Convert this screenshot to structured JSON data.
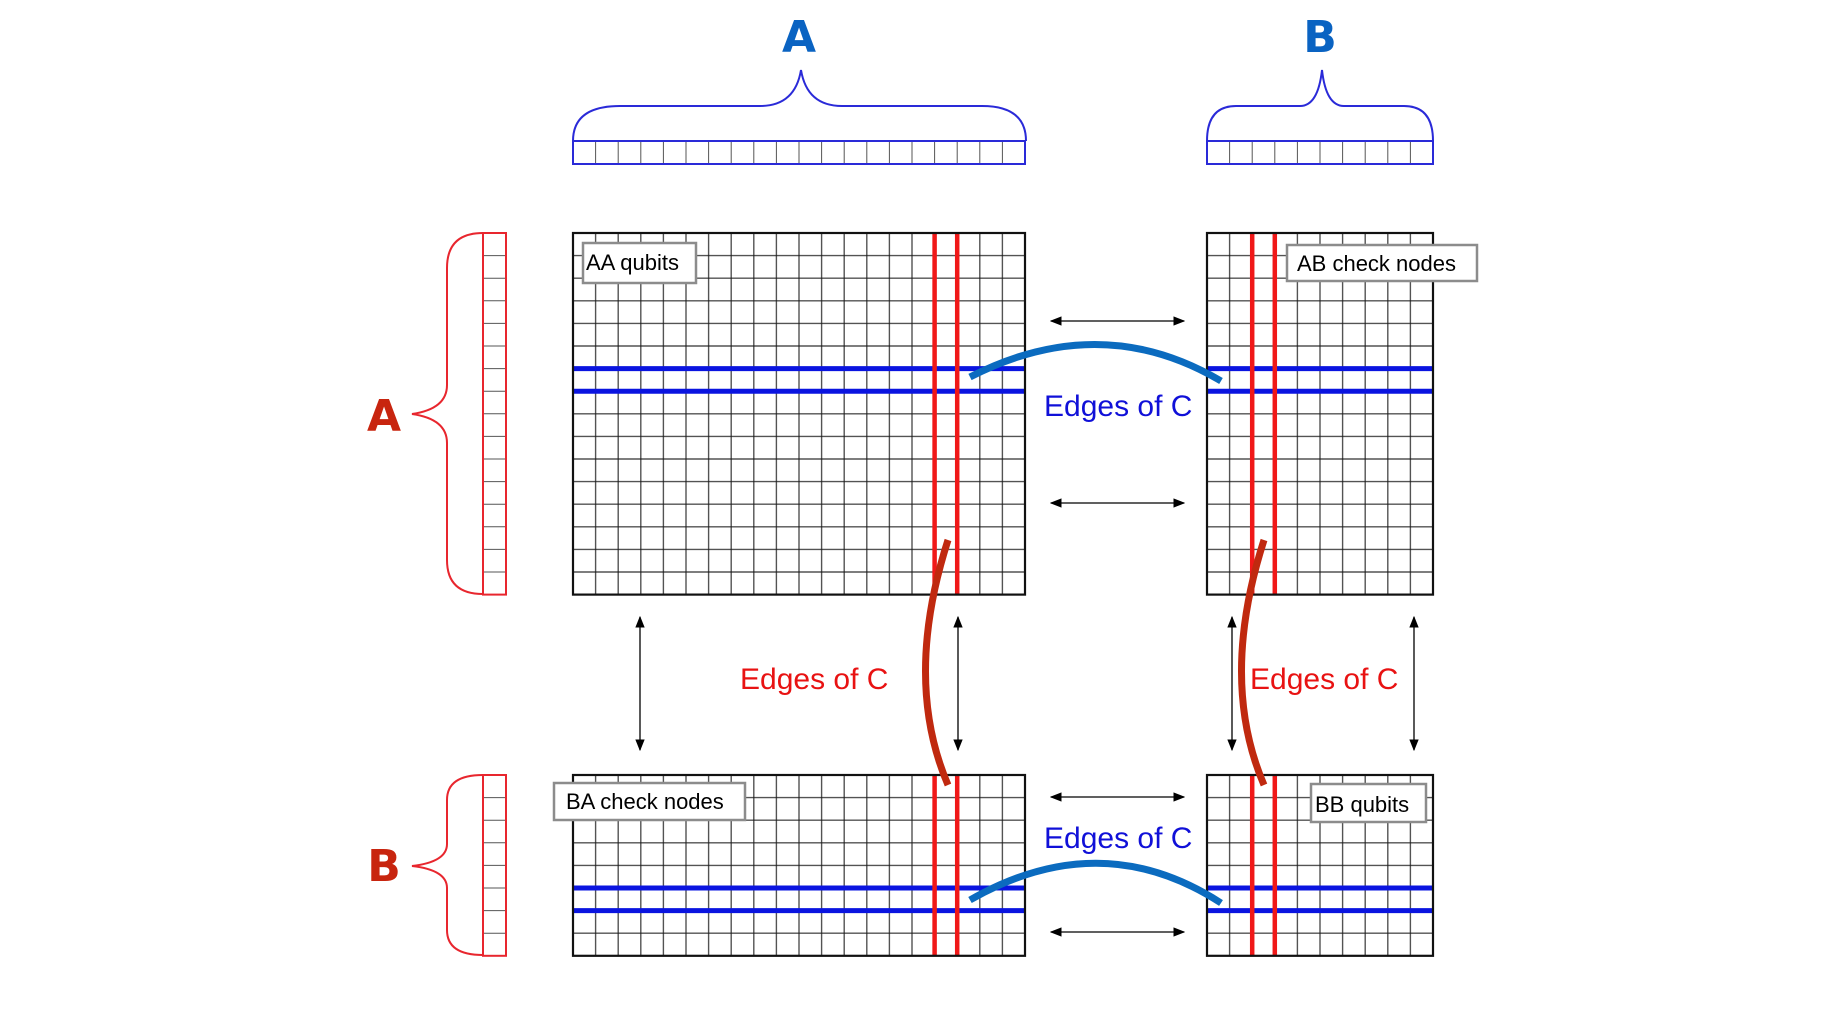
{
  "colors": {
    "column_blue": "#0a63c2",
    "row_red": "#c8250f",
    "brace_blue": "#2a2ad8",
    "brace_red": "#e8262e",
    "highlight_red": "#f01818",
    "highlight_blue": "#0a14e0",
    "edge_arc_blue": "#0b6bbf",
    "edge_arc_red": "#c0290f",
    "edge_label_red": "#e81212",
    "edge_label_blue": "#1010d8",
    "grid": "#1a1a1a",
    "label_border": "#8c8c8c"
  },
  "column_partitions": [
    {
      "label": "A",
      "cells": 20
    },
    {
      "label": "B",
      "cells": 10
    }
  ],
  "row_partitions": [
    {
      "label": "A",
      "cells": 16
    },
    {
      "label": "B",
      "cells": 8
    }
  ],
  "blocks": [
    {
      "id": "AA",
      "label": "AA qubits",
      "cols": 20,
      "rows": 16,
      "red_cols": [
        16,
        17
      ],
      "blue_rows": [
        6,
        7
      ]
    },
    {
      "id": "AB",
      "label": "AB check nodes",
      "cols": 10,
      "rows": 16,
      "red_cols": [
        2,
        3
      ],
      "blue_rows": [
        6,
        7
      ]
    },
    {
      "id": "BA",
      "label": "BA check nodes",
      "cols": 20,
      "rows": 8,
      "red_cols": [
        16,
        17
      ],
      "blue_rows": [
        5,
        6
      ]
    },
    {
      "id": "BB",
      "label": "BB qubits",
      "cols": 10,
      "rows": 8,
      "red_cols": [
        2,
        3
      ],
      "blue_rows": [
        5,
        6
      ]
    }
  ],
  "edge_labels": {
    "top": "Edges of C",
    "bottom": "Edges of C",
    "left": "Edges of C",
    "right": "Edges of C"
  }
}
